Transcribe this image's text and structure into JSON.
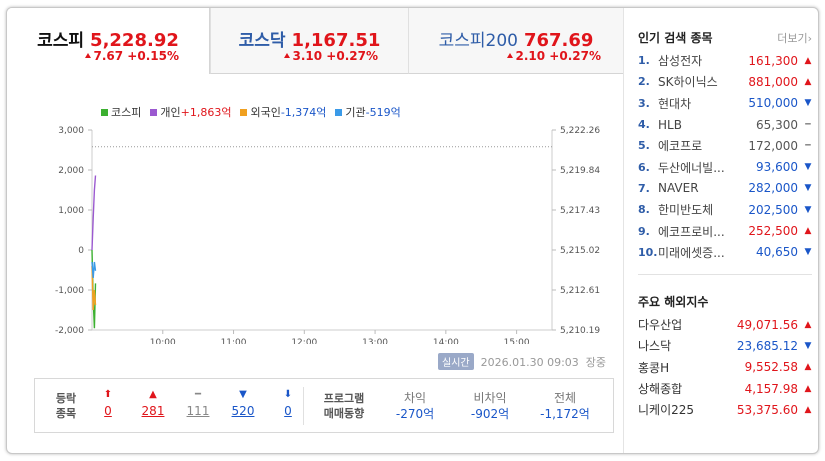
{
  "tabs": [
    {
      "name": "코스피",
      "value": "5,228.92",
      "change": "7.67 +0.15%",
      "active": true
    },
    {
      "name": "코스닥",
      "value": "1,167.51",
      "change": "3.10 +0.27%",
      "active": false
    },
    {
      "name": "코스피200",
      "value": "767.69",
      "change": "2.10 +0.27%",
      "active": false
    }
  ],
  "legend": [
    {
      "name": "코스피",
      "value": "",
      "color": "#3cb030",
      "value_tone": ""
    },
    {
      "name": "개인",
      "value": "+1,863억",
      "color": "#9b59d0",
      "value_tone": "pos"
    },
    {
      "name": "외국인",
      "value": "-1,374억",
      "color": "#f0a020",
      "value_tone": "neg"
    },
    {
      "name": "기관",
      "value": "-519억",
      "color": "#3a9ae8",
      "value_tone": "neg"
    }
  ],
  "chart_data": {
    "type": "line",
    "left_axis_ticks": [
      "3,000",
      "2,000",
      "1,000",
      "0",
      "-1,000",
      "-2,000"
    ],
    "right_axis_ticks": [
      "5,222.26",
      "5,219.84",
      "5,217.43",
      "5,215.02",
      "5,212.61",
      "5,210.19"
    ],
    "x_ticks": [
      "10:00",
      "11:00",
      "12:00",
      "13:00",
      "14:00",
      "15:00"
    ],
    "left_ylim": [
      -2000,
      3000
    ],
    "right_ylim": [
      5210.19,
      5222.26
    ],
    "x_range": [
      "09:00",
      "15:30"
    ],
    "reference_line": 5221.25,
    "series": [
      {
        "name": "코스피",
        "color": "#3cb030",
        "axis": "right",
        "x": [
          "09:00",
          "09:01",
          "09:02",
          "09:03"
        ],
        "values": [
          5215.02,
          5212.0,
          5210.3,
          5213.0
        ]
      },
      {
        "name": "개인",
        "color": "#9b59d0",
        "axis": "left",
        "x": [
          "09:00",
          "09:01",
          "09:02",
          "09:03"
        ],
        "values": [
          0,
          800,
          1500,
          1863
        ]
      },
      {
        "name": "외국인",
        "color": "#f0a020",
        "axis": "left",
        "x": [
          "09:00",
          "09:01",
          "09:02",
          "09:03"
        ],
        "values": [
          -400,
          -1500,
          -1000,
          -1374
        ]
      },
      {
        "name": "기관",
        "color": "#3a9ae8",
        "axis": "left",
        "x": [
          "09:00",
          "09:01",
          "09:02",
          "09:03"
        ],
        "values": [
          -300,
          -700,
          -300,
          -519
        ]
      }
    ]
  },
  "status": {
    "badge": "실시간",
    "datetime": "2026.01.30 09:03",
    "state": "장중"
  },
  "breadth": {
    "label_line1": "등락",
    "label_line2": "종목",
    "items": [
      {
        "icon": "upper-limit-arrow-icon",
        "glyph": "⬆",
        "count": "0",
        "tone": "up"
      },
      {
        "icon": "rise-triangle-icon",
        "glyph": "▲",
        "count": "281",
        "tone": "up"
      },
      {
        "icon": "flat-dash-icon",
        "glyph": "━",
        "count": "111",
        "tone": "flat"
      },
      {
        "icon": "fall-triangle-icon",
        "glyph": "▼",
        "count": "520",
        "tone": "down"
      },
      {
        "icon": "lower-limit-arrow-icon",
        "glyph": "⬇",
        "count": "0",
        "tone": "down"
      }
    ]
  },
  "program": {
    "label_line1": "프로그램",
    "label_line2": "매매동향",
    "items": [
      {
        "title": "차익",
        "value": "-270억"
      },
      {
        "title": "비차익",
        "value": "-902억"
      },
      {
        "title": "전체",
        "value": "-1,172억"
      }
    ]
  },
  "popular": {
    "title": "인기 검색 종목",
    "more": "더보기",
    "items": [
      {
        "rank": "1.",
        "name": "삼성전자",
        "price": "161,300",
        "dir": "up"
      },
      {
        "rank": "2.",
        "name": "SK하이닉스",
        "price": "881,000",
        "dir": "up"
      },
      {
        "rank": "3.",
        "name": "현대차",
        "price": "510,000",
        "dir": "down"
      },
      {
        "rank": "4.",
        "name": "HLB",
        "price": "65,300",
        "dir": "flat"
      },
      {
        "rank": "5.",
        "name": "에코프로",
        "price": "172,000",
        "dir": "flat"
      },
      {
        "rank": "6.",
        "name": "두산에너빌...",
        "price": "93,600",
        "dir": "down"
      },
      {
        "rank": "7.",
        "name": "NAVER",
        "price": "282,000",
        "dir": "down"
      },
      {
        "rank": "8.",
        "name": "한미반도체",
        "price": "202,500",
        "dir": "down"
      },
      {
        "rank": "9.",
        "name": "에코프로비...",
        "price": "252,500",
        "dir": "up"
      },
      {
        "rank": "10.",
        "name": "미래에셋증...",
        "price": "40,650",
        "dir": "down"
      }
    ]
  },
  "overseas": {
    "title": "주요 해외지수",
    "items": [
      {
        "name": "다우산업",
        "value": "49,071.56",
        "dir": "up"
      },
      {
        "name": "나스닥",
        "value": "23,685.12",
        "dir": "down"
      },
      {
        "name": "홍콩H",
        "value": "9,552.58",
        "dir": "up"
      },
      {
        "name": "상해종합",
        "value": "4,157.98",
        "dir": "up"
      },
      {
        "name": "니케이225",
        "value": "53,375.60",
        "dir": "up"
      }
    ]
  },
  "colors": {
    "up": "#e0151b",
    "down": "#1a56c8",
    "flat": "#888888",
    "accent": "#2f5da8"
  }
}
